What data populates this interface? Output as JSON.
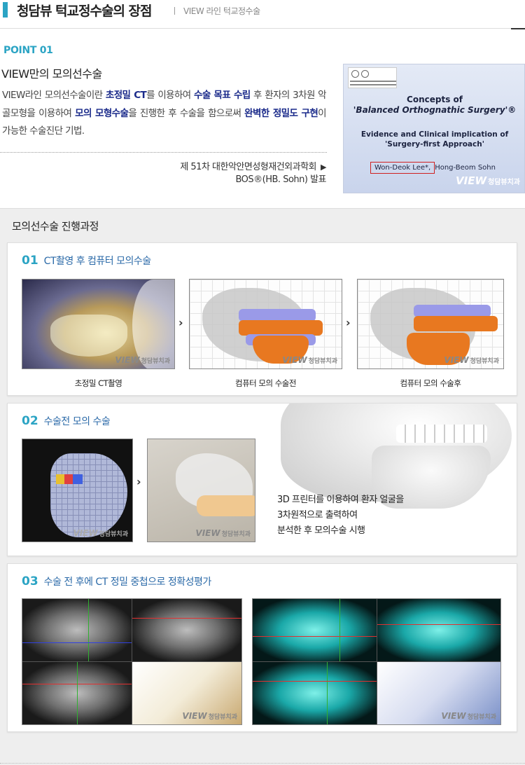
{
  "header": {
    "title": "청담뷰 턱교정수술의 장점",
    "subtitle": "VIEW 라인 턱교정수술"
  },
  "point": {
    "label": "POINT 01",
    "title": "VIEW만의 모의선수술",
    "desc": {
      "t1": "VIEW라인 모의선수술이란 ",
      "h1": "초정밀 CT",
      "t2": "를 이용하여 ",
      "h2": "수술 목표 수립",
      "t3": " 후 환자의 3차원 악골모형을 이용하여 ",
      "h3": "모의 모형수술",
      "t4": "을 진행한 후 수술을 함으로써 ",
      "h4": "완벽한 정밀도 구현",
      "t5": "이 가능한 수술진단 기법."
    },
    "conference_line1": "제 51차 대한악안면성형재건외과학회",
    "conference_arrow": "▶",
    "conference_line2": "BOS®(HB. Sohn) 발표"
  },
  "paper": {
    "title1": "Concepts of",
    "title2": "'Balanced Orthognathic Surgery'®",
    "sub1": "Evidence and Clinical implication of",
    "sub2": "'Surgery-first Approach'",
    "author1": "Won-Deok Lee*,",
    "author2": "Hong-Beom Sohn",
    "brand_view": "VIEW",
    "brand_name": "청담뷰치과"
  },
  "process": {
    "title": "모의선수술 진행과정",
    "step1": {
      "num": "01",
      "title": "CT촬영 후 컴퓨터 모의수술",
      "captions": [
        "초정밀 CT촬영",
        "컴퓨터 모의 수술전",
        "컴퓨터 모의 수술후"
      ]
    },
    "step2": {
      "num": "02",
      "title": "수술전 모의 수술",
      "desc": [
        "3D 프린터를 이용하여 환자 얼굴을",
        "3차원적으로 출력하여",
        "분석한 후 모의수술 시행"
      ]
    },
    "step3": {
      "num": "03",
      "title": "수술 전 후에 CT 정밀 중첩으로 정확성평가"
    }
  },
  "watermark": {
    "view": "VIEW",
    "name": "청담뷰치과"
  },
  "colors": {
    "accent": "#2ba4c4",
    "highlight": "#1a2a8a",
    "step_title": "#2b6aa8",
    "orange": "#e87820",
    "lavender": "#9a9ae8"
  },
  "icons": {
    "next": "chevron-right-icon",
    "arrow": "triangle-right-icon"
  }
}
